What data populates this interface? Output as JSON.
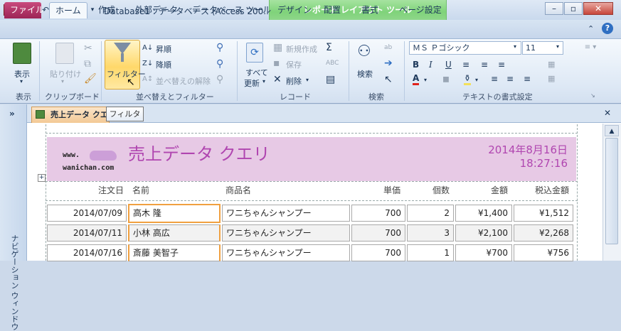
{
  "titlebar": {
    "title": "Database1 : データベース (Access 200...",
    "context_group": "レポート レイアウト ツール"
  },
  "tabs": [
    "ファイル",
    "ホーム",
    "作成",
    "外部データ",
    "データベース ツール",
    "デザイン",
    "配置",
    "書式",
    "ページ設定"
  ],
  "ribbon": {
    "view": {
      "label": "表示",
      "group": "表示"
    },
    "clipboard": {
      "paste": "貼り付け",
      "group": "クリップボード"
    },
    "sort": {
      "filter": "フィルター",
      "ascending": "昇順",
      "descending": "降順",
      "clear_sort": "並べ替えの解除",
      "group": "並べ替えとフィルター"
    },
    "records": {
      "refresh_line1": "すべて",
      "refresh_line2": "更新",
      "new": "新規作成",
      "save": "保存",
      "delete": "削除",
      "totals": "Σ",
      "group": "レコード"
    },
    "find": {
      "label": "検索",
      "group": "検索"
    },
    "text_format": {
      "font": "ＭＳ Ｐゴシック",
      "size": "11",
      "group": "テキストの書式設定"
    }
  },
  "doc_tab": {
    "label": "売上データ クエ",
    "tooltip": "フィルター"
  },
  "nav_pane": {
    "label": "ナビゲーション ウィンドウ"
  },
  "report": {
    "logo_line1": "www.",
    "logo_line2": "wanichan.com",
    "title": "売上データ クエリ",
    "date": "2014年8月16日",
    "time": "18:27:16",
    "columns": [
      "注文日",
      "名前",
      "商品名",
      "単価",
      "個数",
      "金額",
      "税込金額"
    ],
    "rows": [
      [
        "2014/07/09",
        "高木 隆",
        "ワニちゃんシャンプー",
        "700",
        "2",
        "¥1,400",
        "¥1,512"
      ],
      [
        "2014/07/11",
        "小林 高広",
        "ワニちゃんシャンプー",
        "700",
        "3",
        "¥2,100",
        "¥2,268"
      ],
      [
        "2014/07/16",
        "斎藤 美智子",
        "ワニちゃんシャンプー",
        "700",
        "1",
        "¥700",
        "¥756"
      ]
    ]
  },
  "colors": {
    "file_tab": "#b23467",
    "context_tab": "#7fd37a",
    "report_header": "#e7c9e5",
    "title_text": "#b046b0",
    "selection": "#f0a040"
  }
}
